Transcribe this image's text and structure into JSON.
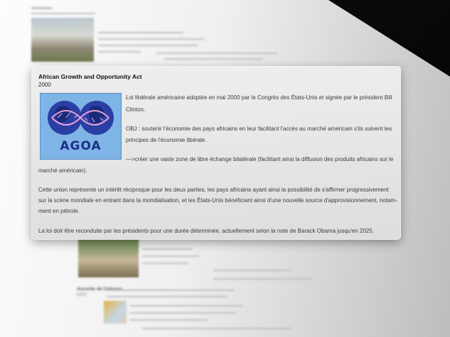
{
  "popup": {
    "title": "African Growth and Opportunity Act",
    "year": "2000",
    "logo_text": "AGOA",
    "p1_line1": "Loi fédérale américaine adoptée en mai 2000 par le Congrès des États-Unis et signée par le président Bill",
    "p1_line2": "Clinton.",
    "p2_line1": "OBJ : soutenir l'économie des pays africains en leur facilitant l'accès au marché américain s'ils suivent les",
    "p2_line2": "principes de l'économie libérale.",
    "p3_line1": "—>créer une vaste zone de libre échange bilatérale (facilitant ainsi la diffusion des produits africains sur le",
    "p3_line2": "marché américain).",
    "p4_line1": "Cette union représente un intérêt réciproque pour les deux parties, les pays africains ayant ainsi la possibilité de s'affirmer progressivement",
    "p4_line2": "sur la scène mondiale en entrant dans la mondialisation, et les États-Unis bénéficiant ainsi d'une nouvelle source d'approvisionnement, notam-",
    "p4_line3": "ment en pétrole.",
    "p5_line1": "La loi doit être reconduite par les présidents pour une durée déterminée, actuellement selon la note de Barack Obama jusqu'en 2025."
  },
  "background": {
    "section_heading": "Accords de Cotonou",
    "section_year": "2000"
  },
  "colors": {
    "card_bg": "#e6e6e6",
    "logo_bg": "#7fb4e6",
    "logo_text": "#1e2f8a",
    "corner": "#000000"
  }
}
